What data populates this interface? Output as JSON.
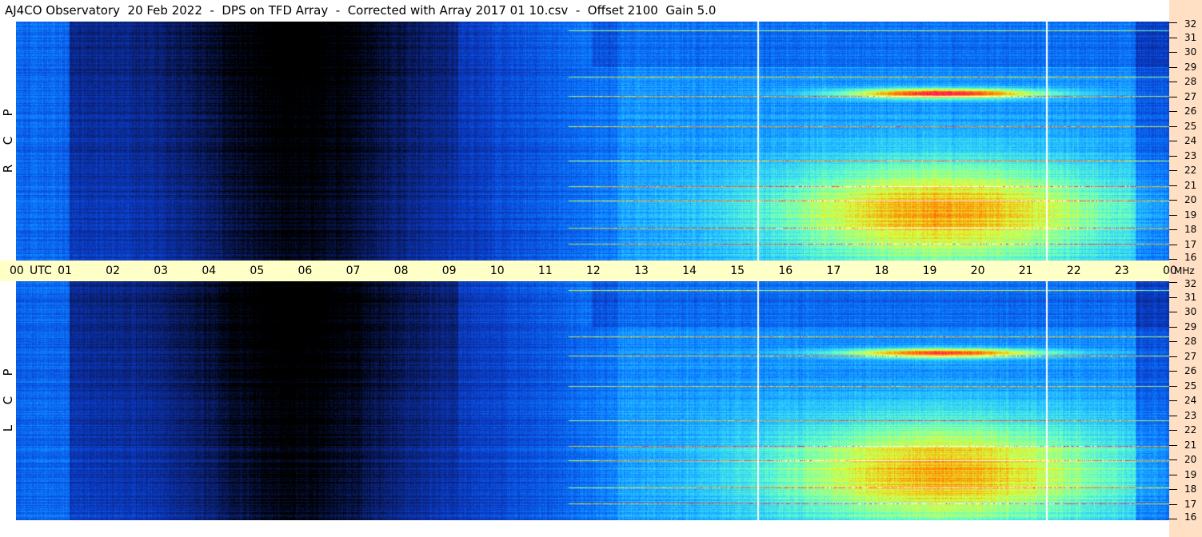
{
  "title": "AJ4CO Observatory  20 Feb 2022  -  DPS on TFD Array  -  Corrected with Array 2017 01 10.csv  -  Offset 2100  Gain 5.0",
  "colors": {
    "axis_band": "#ffffc8",
    "freq_strip": "#ffe0c4",
    "colormap": [
      "#000000",
      "#0a1e6e",
      "#0a3cc8",
      "#0a78ff",
      "#28c8ff",
      "#64ffc8",
      "#dcff3c",
      "#ff8c00",
      "#ff0064",
      "#ffffff"
    ]
  },
  "panels": [
    {
      "polarization": [
        "R",
        "C",
        "P"
      ]
    },
    {
      "polarization": [
        "L",
        "C",
        "P"
      ]
    }
  ],
  "time_axis": {
    "labels": [
      "00",
      "01",
      "02",
      "03",
      "04",
      "05",
      "06",
      "07",
      "08",
      "09",
      "10",
      "11",
      "12",
      "13",
      "14",
      "15",
      "16",
      "17",
      "18",
      "19",
      "20",
      "21",
      "22",
      "23",
      "00"
    ],
    "unit_left": "UTC",
    "unit_right": "MHz"
  },
  "chart_data": {
    "type": "heatmap",
    "title": "AJ4CO Observatory  20 Feb 2022  -  DPS on TFD Array  -  Corrected with Array 2017 01 10.csv  -  Offset 2100  Gain 5.0",
    "xlabel": "UTC",
    "ylabel": "MHz",
    "x_ticks": [
      "00",
      "01",
      "02",
      "03",
      "04",
      "05",
      "06",
      "07",
      "08",
      "09",
      "10",
      "11",
      "12",
      "13",
      "14",
      "15",
      "16",
      "17",
      "18",
      "19",
      "20",
      "21",
      "22",
      "23",
      "00"
    ],
    "x_range_hours": [
      0,
      24
    ],
    "y_ticks": [
      16,
      17,
      18,
      19,
      20,
      21,
      22,
      23,
      24,
      25,
      26,
      27,
      28,
      29,
      30,
      31,
      32
    ],
    "y_range_mhz": [
      16,
      32
    ],
    "panels": [
      "RCP",
      "LCP"
    ],
    "features": {
      "daytime_power_peak_utc": 19.3,
      "daytime_rise_utc": 12.0,
      "daytime_fall_utc": 23.5,
      "quiet_night_utc": [
        3,
        9
      ],
      "vertical_gaps_utc": [
        15.45,
        21.45
      ],
      "bright_band_mhz": 27.2,
      "interference_lines_mhz": [
        17.1,
        18.2,
        20.0,
        21.0,
        22.7,
        25.0,
        27.0,
        28.3,
        31.4
      ]
    }
  }
}
